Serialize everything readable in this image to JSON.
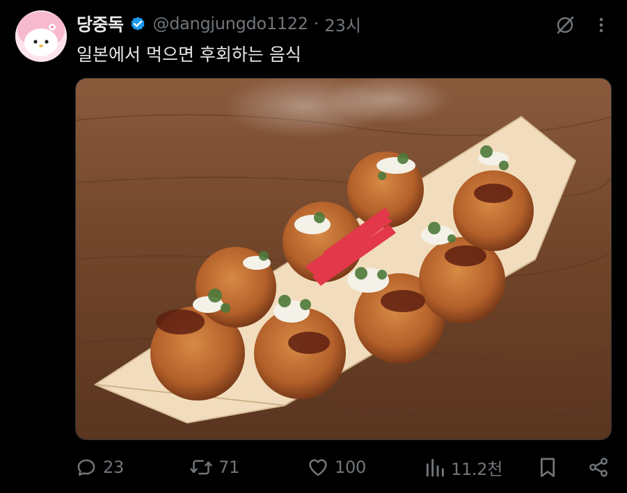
{
  "tweet": {
    "author": {
      "display_name": "당중독",
      "verified": true,
      "handle": "@dangjungdo1122",
      "avatar_icon": "my-melody-avatar"
    },
    "separator": "·",
    "time": "23시",
    "text": "일본에서 먹으면 후회하는 음식",
    "media_icon": "takoyaki-photo",
    "actions": {
      "reply": {
        "icon": "reply-icon",
        "count": "23"
      },
      "retweet": {
        "icon": "retweet-icon",
        "count": "71"
      },
      "like": {
        "icon": "heart-icon",
        "count": "100"
      },
      "views": {
        "icon": "views-icon",
        "count": "11.2천"
      },
      "bookmark": {
        "icon": "bookmark-icon"
      },
      "share": {
        "icon": "share-icon"
      }
    }
  },
  "colors": {
    "background": "#000000",
    "primary_text": "#e7e9ea",
    "secondary_text": "#71767b",
    "verified_blue": "#1d9bf0"
  }
}
